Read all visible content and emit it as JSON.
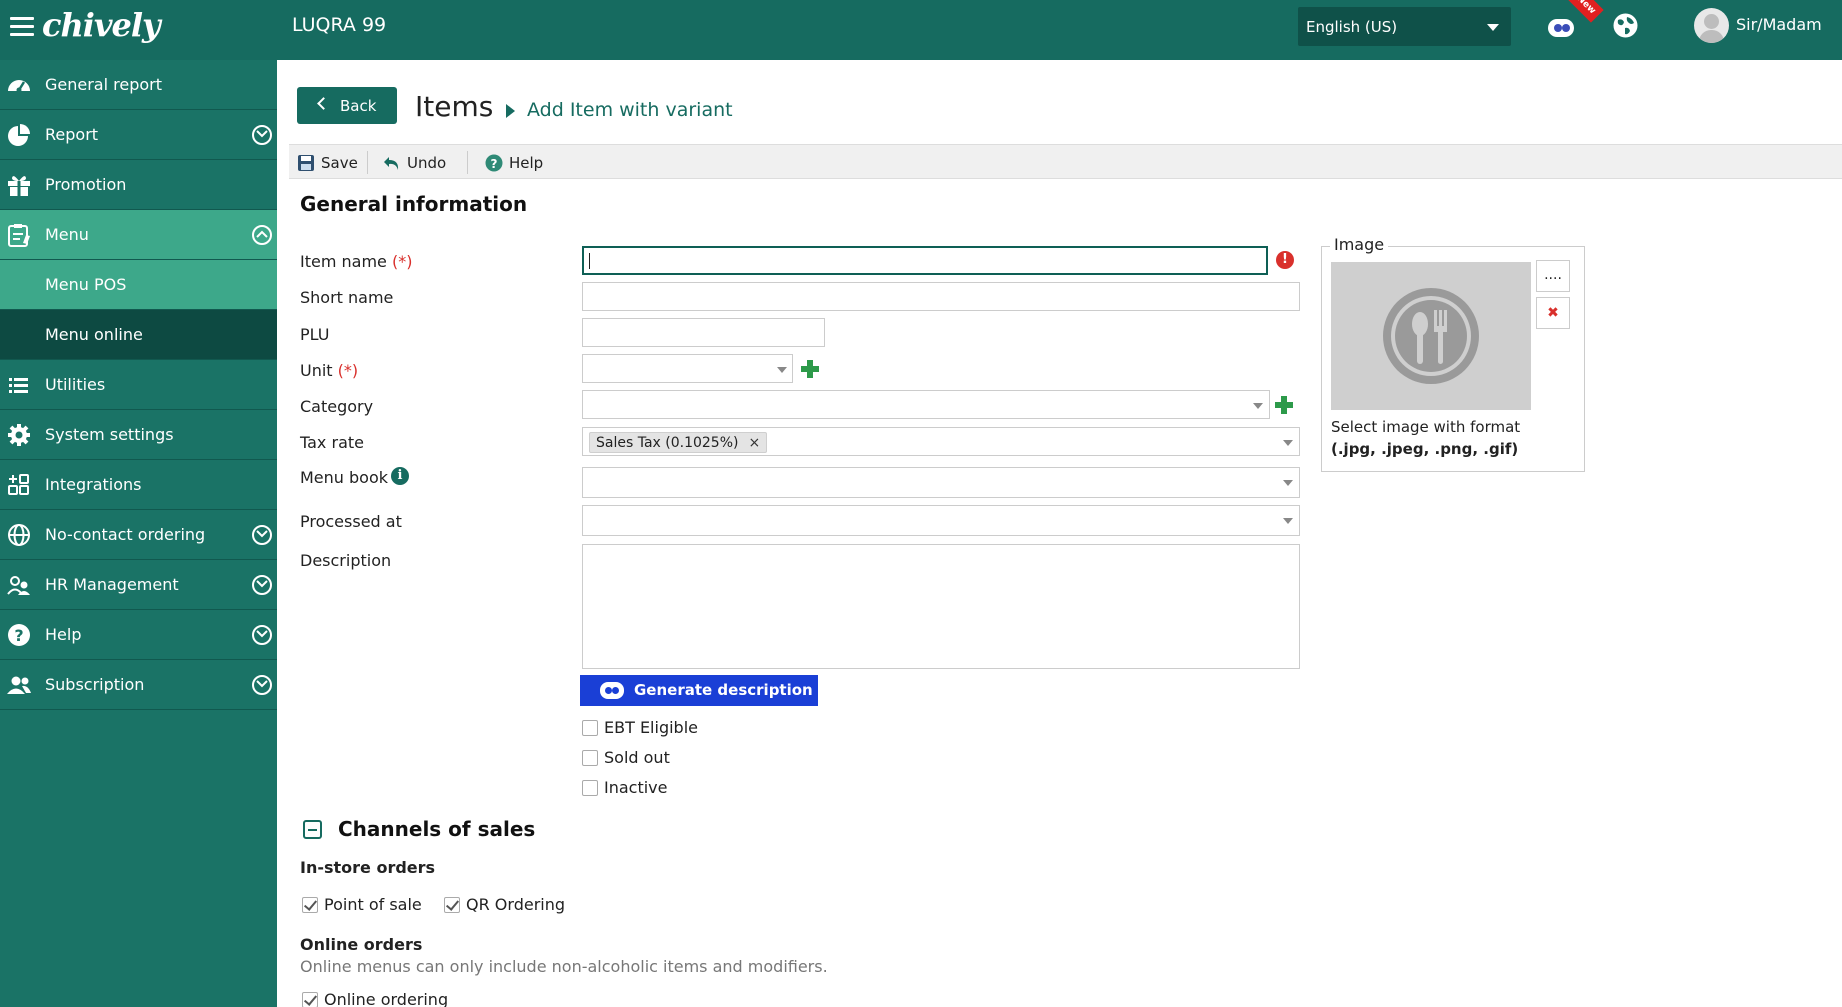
{
  "app": {
    "logo": "chively",
    "store_name": "LUQRA 99"
  },
  "topbar": {
    "language": "English (US)",
    "user": "Sir/Madam",
    "robot_badge": "New"
  },
  "sidebar": {
    "items": [
      {
        "label": "General report",
        "icon": "dashboard-icon"
      },
      {
        "label": "Report",
        "icon": "pie-chart-icon"
      },
      {
        "label": "Promotion",
        "icon": "gift-icon"
      },
      {
        "label": "Menu",
        "icon": "clipboard-icon"
      },
      {
        "label": "Menu POS"
      },
      {
        "label": "Menu online"
      },
      {
        "label": "Utilities",
        "icon": "list-icon"
      },
      {
        "label": "System settings",
        "icon": "gear-icon"
      },
      {
        "label": "Integrations",
        "icon": "grid-icon"
      },
      {
        "label": "No-contact ordering",
        "icon": "globe-icon"
      },
      {
        "label": "HR Management",
        "icon": "users-icon"
      },
      {
        "label": "Help",
        "icon": "help-icon"
      },
      {
        "label": "Subscription",
        "icon": "user-group-icon"
      }
    ]
  },
  "header": {
    "back_label": "Back",
    "title": "Items",
    "breadcrumb": "Add Item with variant"
  },
  "toolbar": {
    "save": "Save",
    "undo": "Undo",
    "help": "Help"
  },
  "form": {
    "section_title": "General information",
    "item_name": {
      "label": "Item name",
      "required": "(*)",
      "value": ""
    },
    "short_name": {
      "label": "Short name",
      "value": ""
    },
    "plu": {
      "label": "PLU",
      "value": ""
    },
    "unit": {
      "label": "Unit",
      "required": "(*)",
      "value": ""
    },
    "category": {
      "label": "Category",
      "value": ""
    },
    "tax_rate": {
      "label": "Tax rate",
      "tag": "Sales Tax (0.1025%)",
      "tag_remove": "×"
    },
    "menu_book": {
      "label": "Menu book",
      "value": ""
    },
    "processed_at": {
      "label": "Processed at",
      "value": ""
    },
    "description": {
      "label": "Description",
      "value": ""
    },
    "generate_btn": "Generate description",
    "ebt": "EBT Eligible",
    "sold_out": "Sold out",
    "inactive": "Inactive"
  },
  "image": {
    "legend": "Image",
    "browse": "....",
    "remove": "✖",
    "note": "Select image with format",
    "formats": "(.jpg, .jpeg, .png, .gif)"
  },
  "channels": {
    "title": "Channels of sales",
    "in_store_title": "In-store orders",
    "pos": {
      "label": "Point of sale",
      "checked": true
    },
    "qr": {
      "label": "QR Ordering",
      "checked": true
    },
    "online_title": "Online orders",
    "online_hint": "Online menus can only include non-alcoholic items and modifiers.",
    "online": {
      "label": "Online ordering",
      "checked": true
    }
  },
  "colors": {
    "brand": "#166b60",
    "sidebar": "#1a7366",
    "active": "#3da88a",
    "accent_button": "#1a3fd6"
  }
}
